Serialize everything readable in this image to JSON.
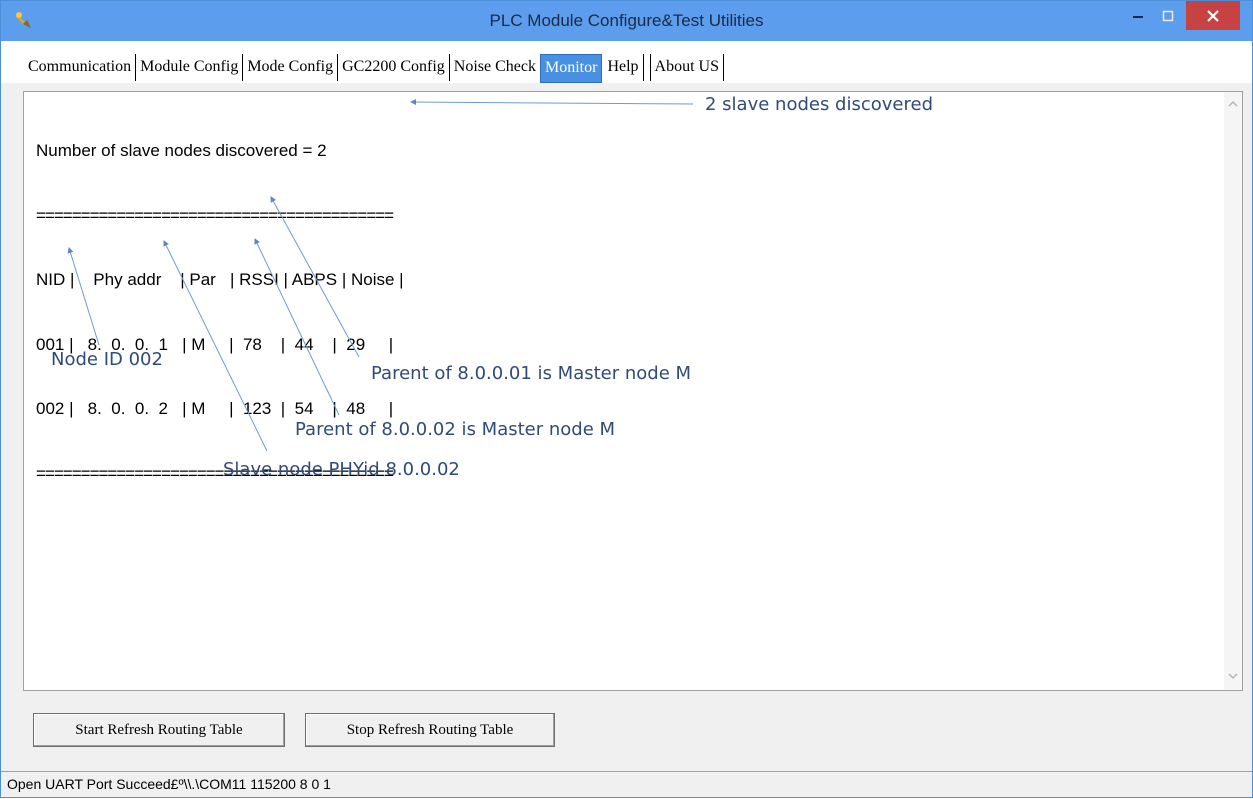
{
  "window": {
    "title": "PLC Module Configure&Test Utilities"
  },
  "tabs": [
    {
      "label": "Communication"
    },
    {
      "label": "Module Config"
    },
    {
      "label": "Mode Config"
    },
    {
      "label": "GC2200 Config"
    },
    {
      "label": "Noise Check"
    },
    {
      "label": "Monitor",
      "active": true
    },
    {
      "label": "Help"
    },
    {
      "label": "About US"
    }
  ],
  "console": {
    "line1": "Number of slave nodes discovered = 2",
    "line2": "========================================",
    "header": "NID |    Phy addr    | Par   | RSSI | ABPS | Noise |",
    "row1": "001 |   8.  0.  0.  1   | M     |  78    |  44    |  29     |",
    "row2": "002 |   8.  0.  0.  2   | M     |  123  |  54    |  48     |",
    "line3": "========================================"
  },
  "annotations": {
    "slave_nodes": "2 slave nodes discovered",
    "node_id": "Node ID 002",
    "parent1": "Parent of 8.0.0.01 is Master node M",
    "parent2": "Parent of 8.0.0.02 is Master node M",
    "phyid": "Slave node PHYid 8.0.0.02"
  },
  "buttons": {
    "start": "Start Refresh Routing Table",
    "stop": "Stop Refresh Routing Table"
  },
  "status": "Open UART Port Succeed£º\\\\.\\COM11 115200 8 0 1",
  "colors": {
    "title_bar": "#5c9ded",
    "active_tab": "#4a90e2",
    "annotation": "#2f4b78",
    "close_button": "#c74343"
  }
}
